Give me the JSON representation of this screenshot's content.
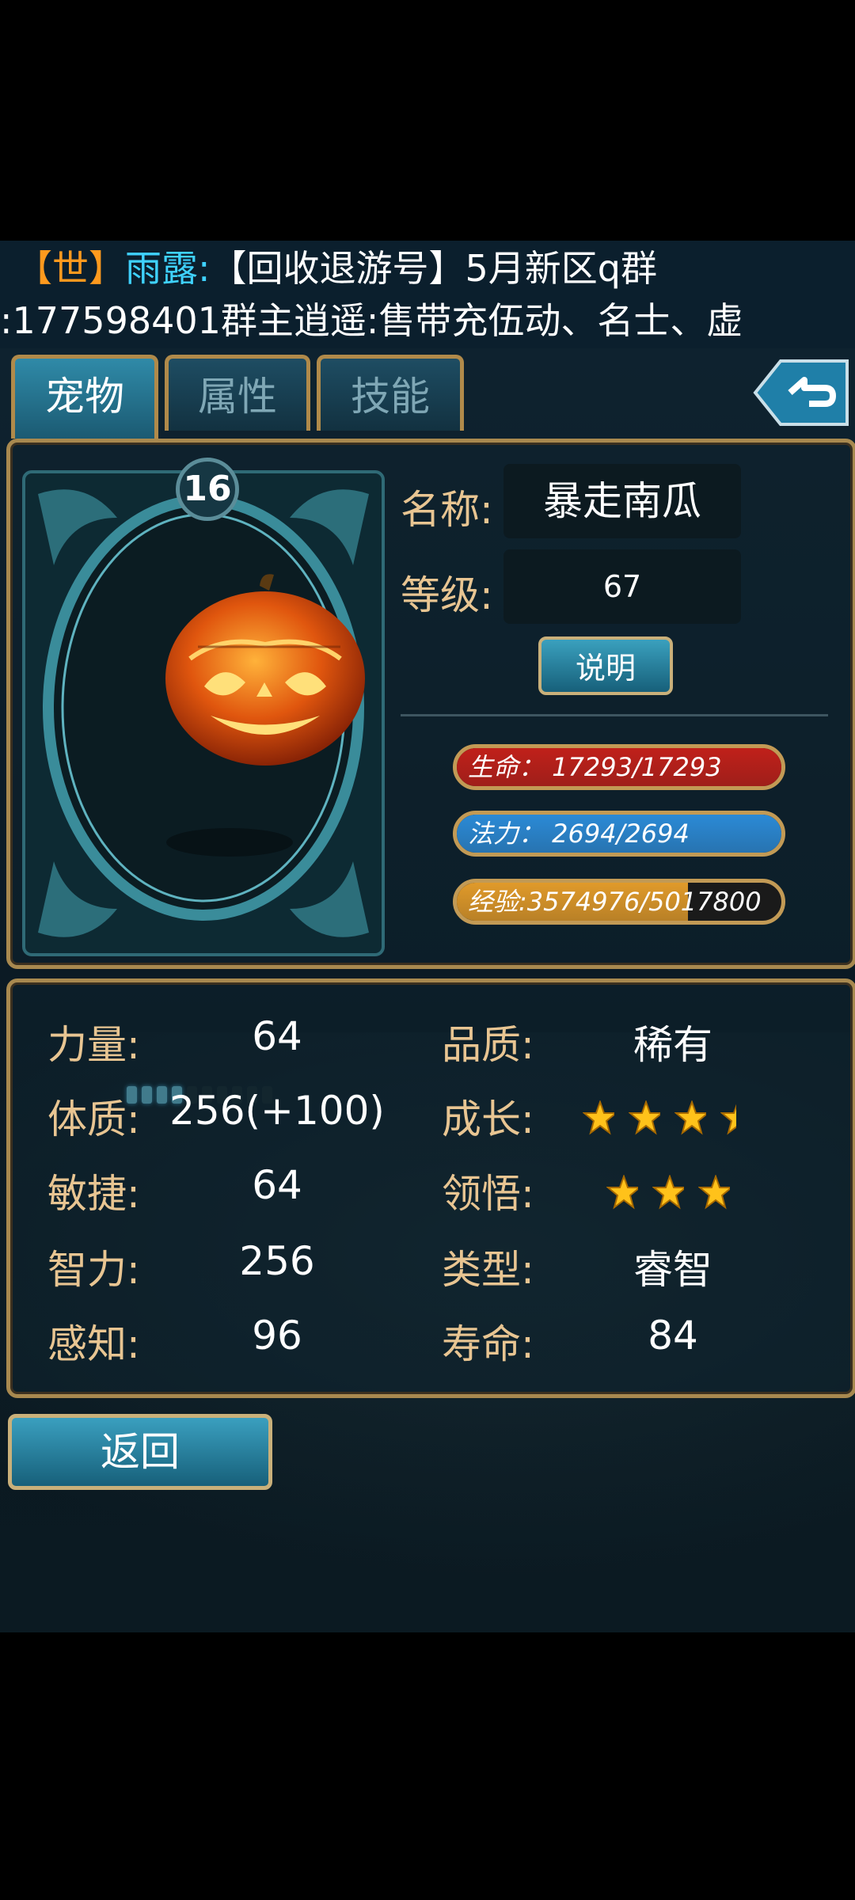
{
  "chat": {
    "tag": "【世】",
    "sender": "雨露:",
    "message_line1": "【回收退游号】5月新区q群",
    "message_line2": ":177598401群主逍遥:售带充伍动、名士、虚"
  },
  "tabs": [
    {
      "label": "宠物",
      "active": true
    },
    {
      "label": "属性",
      "active": false
    },
    {
      "label": "技能",
      "active": false
    }
  ],
  "back_icon": "return-arrow-icon",
  "pet": {
    "card_level": "16",
    "name_label": "名称:",
    "name": "暴走南瓜",
    "level_label": "等级:",
    "level": "67",
    "explain_button": "说明",
    "hp": {
      "text": "生命：  17293/17293",
      "fraction": 1.0,
      "color": "#c0201a"
    },
    "mp": {
      "text": "法力：  2694/2694",
      "fraction": 1.0,
      "color": "#2b8ad6"
    },
    "exp": {
      "text": "经验:3574976/5017800",
      "fraction": 0.712,
      "color": "#e09a2a"
    },
    "stat_pips": {
      "filled": 4,
      "total": 10
    }
  },
  "stats": {
    "left": [
      {
        "label": "力量:",
        "value": "64"
      },
      {
        "label": "体质:",
        "value": "256(+100)"
      },
      {
        "label": "敏捷:",
        "value": "64"
      },
      {
        "label": "智力:",
        "value": "256"
      },
      {
        "label": "感知:",
        "value": "96"
      }
    ],
    "quality_label": "品质:",
    "quality": "稀有",
    "growth_label": "成长:",
    "growth_stars": 3.5,
    "insight_label": "领悟:",
    "insight_stars": 3,
    "type_label": "类型:",
    "type": "睿智",
    "life_label": "寿命:",
    "life": "84"
  },
  "return_button": "返回"
}
